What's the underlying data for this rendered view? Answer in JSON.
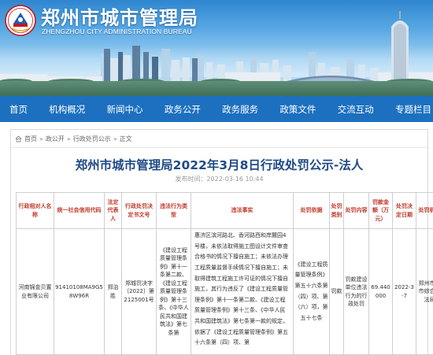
{
  "header": {
    "title": "郑州市城市管理局",
    "subtitle": "ZHENGZHOU CITY ADMINISTRATION BUREAU"
  },
  "nav": {
    "items": [
      {
        "label": "首页"
      },
      {
        "label": "机构概况"
      },
      {
        "label": "新闻中心"
      },
      {
        "label": "政务公开"
      },
      {
        "label": "政务服务"
      },
      {
        "label": "政策文件"
      },
      {
        "label": "交流互动"
      },
      {
        "label": "专题栏目"
      }
    ]
  },
  "breadcrumb": {
    "items": [
      "首页",
      "政公开",
      "行政处罚公示",
      "正文"
    ],
    "separator": "»"
  },
  "article": {
    "title": "郑州市城市管理局2022年3月8日行政处罚公示-法人",
    "published": "发布时间：2022-03-16 10:44"
  },
  "table": {
    "headers": [
      "行政相对人名称",
      "统一社会信用代码",
      "法定代表人",
      "行政处罚决定书文号",
      "违法行为类型",
      "违法事实",
      "处罚依据",
      "处罚类别",
      "处罚内容",
      "罚款金额（万元）",
      "处罚决定日期",
      "处罚机关"
    ],
    "rows": [
      {
        "name": "河南锦金贝置业有限公司",
        "credit_code": "91410108MA9G58W96R",
        "legal_rep": "郑治胜",
        "decision_no": "郑城罚决字〔2022〕第2125001号",
        "violation_type": "《建设工程质量管理条例》第十一条第二款、《建设工程质量管理条例》第十三条、《中华人民共和国建筑法》第七条第",
        "facts": "惠济区滨河路北、香河路西和岸麓园4号楼，未依法取得施工图设计文件审查合格书的情况下擅自施工；未依法办理工程质量监督手续情况下擅自施工；未取得建筑工程施工许可证的情况下擅自施工，其行为违反了《建设工程质量管理条例》第十一条第二款、《建设工程质量管理条例》第十三条、《中华人民共和国建筑法》第七条第一款的规定，依据了《建设工程质量管理条例》第五十六条第（四）项、第",
        "basis": "《建设工程质量管理条例》第五十六条第（四）项、第（六）项，第五十七条",
        "category": "罚款",
        "content": "罚款建设单位违法行为的行政处罚",
        "amount": "69.440000",
        "date": "2022-3-7",
        "authority": "郑州市城市综合执法局"
      }
    ]
  },
  "colors": {
    "nav_bg": "#1c70bf",
    "title_color": "#1f4a86",
    "header_text": "#c0392b"
  }
}
